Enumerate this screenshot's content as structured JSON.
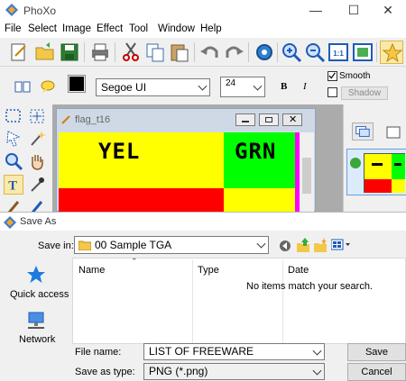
{
  "app": {
    "title": "PhoXo",
    "menu": [
      "File",
      "Select",
      "Image",
      "Effect",
      "Tool",
      "Window",
      "Help"
    ],
    "text_toolbar": {
      "font": "Segoe UI",
      "size": "24",
      "bold": "B",
      "italic": "I",
      "smooth_label": "Smooth",
      "shadow_label": "Shadow",
      "color": "#000000"
    },
    "document": {
      "title": "flag_t16",
      "cells": [
        {
          "label": "YEL",
          "color": "#ffff00"
        },
        {
          "label": "GRN",
          "color": "#00ff00"
        },
        {
          "label": "",
          "color": "#ff0000"
        },
        {
          "label": "",
          "color": "#ffff00"
        }
      ],
      "magenta": "#ff00ff"
    }
  },
  "dialog": {
    "title": "Save As",
    "save_in_label": "Save in:",
    "save_in_value": "00 Sample TGA",
    "columns": [
      "Name",
      "Type",
      "Date"
    ],
    "empty_message": "No items match your search.",
    "places": [
      "Quick access",
      "Network"
    ],
    "file_name_label": "File name:",
    "file_name_value": "LIST OF FREEWARE",
    "save_as_type_label": "Save as type:",
    "save_as_type_value": "PNG (*.png)",
    "save_button": "Save",
    "cancel_button": "Cancel"
  }
}
